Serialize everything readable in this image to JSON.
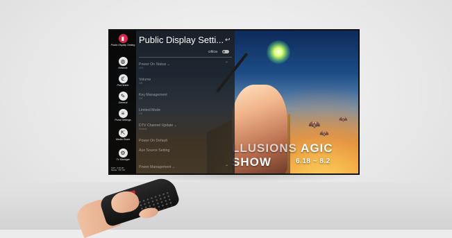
{
  "menu": {
    "title": "Public Display Setti...",
    "offon_label": "Off/On",
    "sidebar": [
      {
        "label": "Public Display Setting",
        "icon": "public-display-icon",
        "active": true
      },
      {
        "label": "Network",
        "icon": "network-icon",
        "active": false
      },
      {
        "label": "ProCentric",
        "icon": "procentric-icon",
        "active": false
      },
      {
        "label": "General",
        "icon": "wrench-icon",
        "active": false
      },
      {
        "label": "Portal Settings",
        "icon": "portal-icon",
        "active": false
      },
      {
        "label": "Media Share",
        "icon": "media-share-icon",
        "active": false
      },
      {
        "label": "TV Manager",
        "icon": "tv-manager-icon",
        "active": false
      }
    ],
    "sidebar_footer": [
      "S/W : 3.00.20",
      "Model : 55*-SS"
    ],
    "items": [
      {
        "label": "Power On Status",
        "value": "LST",
        "expandable": true
      },
      {
        "label": "Volume",
        "value": "Off",
        "expandable": false
      },
      {
        "label": "Key Management",
        "value": "Off",
        "expandable": false
      },
      {
        "label": "Limited Mode",
        "value": "Off",
        "expandable": false
      },
      {
        "label": "DTV Channel Update",
        "value": "Default",
        "expandable": true
      },
      {
        "label": "Power On Default",
        "value": "",
        "expandable": false
      },
      {
        "label": "Aux Source Setting",
        "value": "",
        "expandable": false
      },
      {
        "label": "Power Management",
        "value": "",
        "expandable": true
      }
    ]
  },
  "background": {
    "title_left": "LLUSIONS",
    "title_right": "AGIC SHOW",
    "date": "6.18 ~ 8.2"
  },
  "colors": {
    "accent": "#d8284d",
    "remote_button": "#c9252c"
  }
}
